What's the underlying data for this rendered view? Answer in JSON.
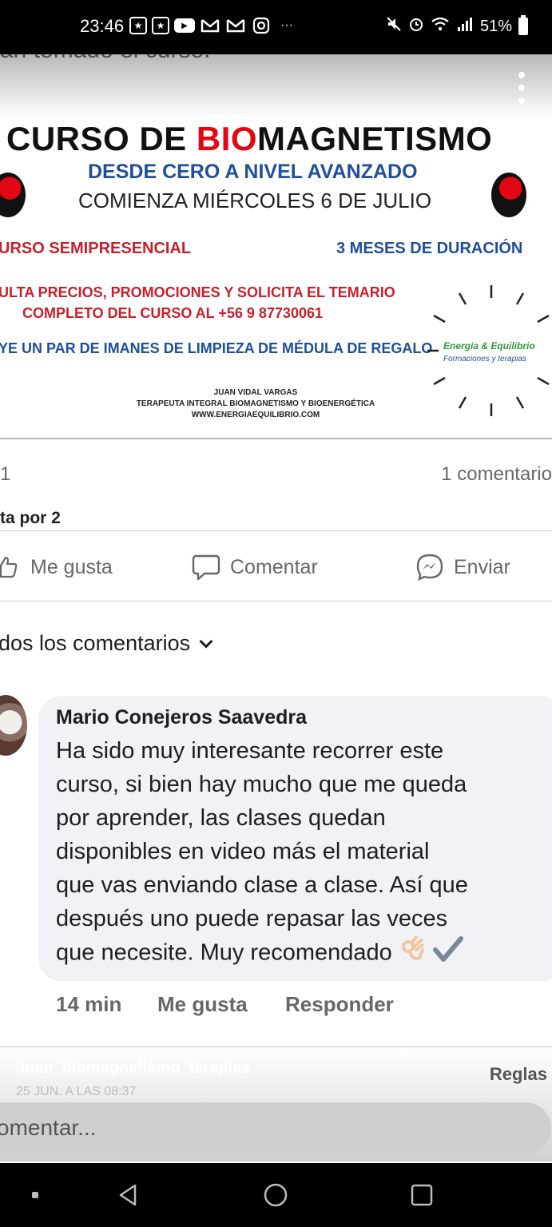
{
  "status_bar": {
    "time": "23:46",
    "notif_more": "···",
    "battery": "51%"
  },
  "banner": {
    "cut_text": "an tomado el curso.",
    "title_pre": "CURSO DE ",
    "title_red": "BIO",
    "title_post": "MAGNETISMO",
    "subtitle1": "DESDE CERO A NIVEL AVANZADO",
    "subtitle2": "COMIENZA MIÉRCOLES 6 DE JULIO",
    "left_red": "URSO SEMIPRESENCIAL",
    "right_blue": "3 MESES DE DURACIÓN",
    "red_line1": "ULTA PRECIOS, PROMOCIONES Y SOLICITA EL TEMARIO",
    "red_line2": "COMPLETO DEL CURSO AL +56 9 87730061",
    "blue_line": "YE UN PAR DE IMANES DE LIMPIEZA DE MÉDULA DE REGALO",
    "small1": "JUAN VIDAL VARGAS",
    "small2": "TERAPEUTA INTEGRAL BIOMAGNETISMO Y BIOENERGÉTICA",
    "small3": "WWW.ENERGIAEQUILIBRIO.COM",
    "logo_line1": "Energía & Equilibrio",
    "logo_line2": "Formaciones y terapias",
    "colors": {
      "red": "#e30613",
      "blue": "#1f4e9d",
      "logo_green": "#2e9b3a"
    }
  },
  "stats": {
    "reactions": "1",
    "comments": "1 comentario",
    "seen_by": "ta por 2"
  },
  "actions": {
    "like": "Me gusta",
    "comment": "Comentar",
    "send": "Enviar"
  },
  "comments_filter": "dos los comentarios",
  "comment": {
    "author": "Mario Conejeros Saavedra",
    "lines": [
      "Ha sido muy interesante recorrer este",
      "curso, si bien hay mucho que me queda",
      "por aprender, las clases quedan",
      "disponibles en video más el material",
      "que vas enviando clase a clase.  Así que",
      "después uno puede repasar las veces",
      "que necesite. Muy recomendado"
    ],
    "emojis": [
      "ok-hand-emoji",
      "check-mark-emoji"
    ],
    "time": "14 min",
    "like": "Me gusta",
    "reply": "Responder"
  },
  "footer": {
    "username": "Juan_biomagnetismo_terapias",
    "date": "25 JUN. A LAS 08:37",
    "rules": "Reglas",
    "input_placeholder": "omentar..."
  }
}
